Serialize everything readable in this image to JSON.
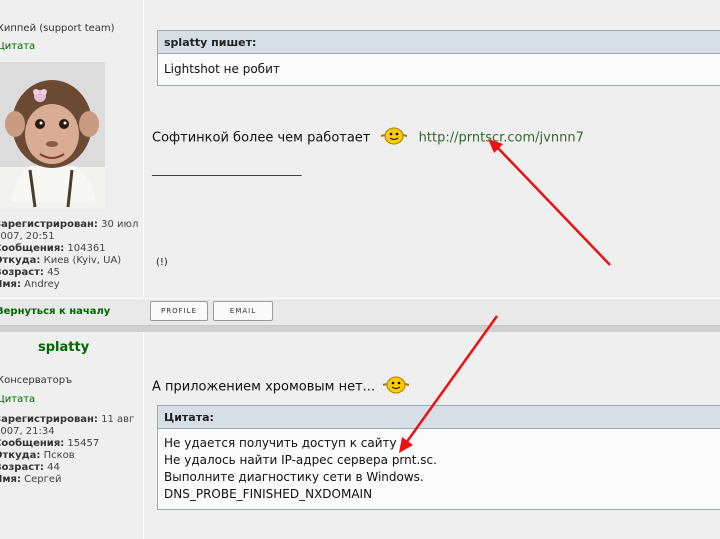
{
  "post1": {
    "author": "Хиппей (support team)",
    "quote_link": "Цитата",
    "info": {
      "registered_label": "Зарегистрирован:",
      "registered_value": "30 июл",
      "registered_value2": "2007, 20:51",
      "messages_label": "Сообщения:",
      "messages_value": "104361",
      "from_label": "Откуда:",
      "from_value": "Киев (Kyiv, UA)",
      "age_label": "Возраст:",
      "age_value": "45",
      "name_label": "Имя:",
      "name_value": "Andrey"
    },
    "quote_header": "splatty пишет:",
    "quote_text": "Lightshot не робит",
    "message_text": "Софтинкой более чем работает",
    "message_url": "http://prntscr.com/jvnnn7",
    "signature_line": "_______________________",
    "exclaim": "(!)",
    "back_to_top": "Вернуться к началу",
    "profile_btn": "PROFILE",
    "email_btn": "EMAIL"
  },
  "post2": {
    "author": "splatty",
    "rank": "Консерваторъ",
    "quote_link": "Цитата",
    "info": {
      "registered_label": "Зарегистрирован:",
      "registered_value": "11 авг",
      "registered_value2": "2007, 21:34",
      "messages_label": "Сообщения:",
      "messages_value": "15457",
      "from_label": "Откуда:",
      "from_value": "Псков",
      "age_label": "Возраст:",
      "age_value": "44",
      "name_label": "Имя:",
      "name_value": "Сергей"
    },
    "message_text": "А приложением хромовым нет...",
    "quote_header": "Цитата:",
    "quote_lines": [
      "Не удается получить доступ к сайту",
      "Не удалось найти IP-адрес сервера prnt.sc.",
      "Выполните диагностику сети в Windows.",
      "DNS_PROBE_FINISHED_NXDOMAIN"
    ]
  },
  "colors": {
    "link_green": "#006600",
    "arrow_red": "#ee1111",
    "quote_header_bg": "#d6dee6"
  }
}
